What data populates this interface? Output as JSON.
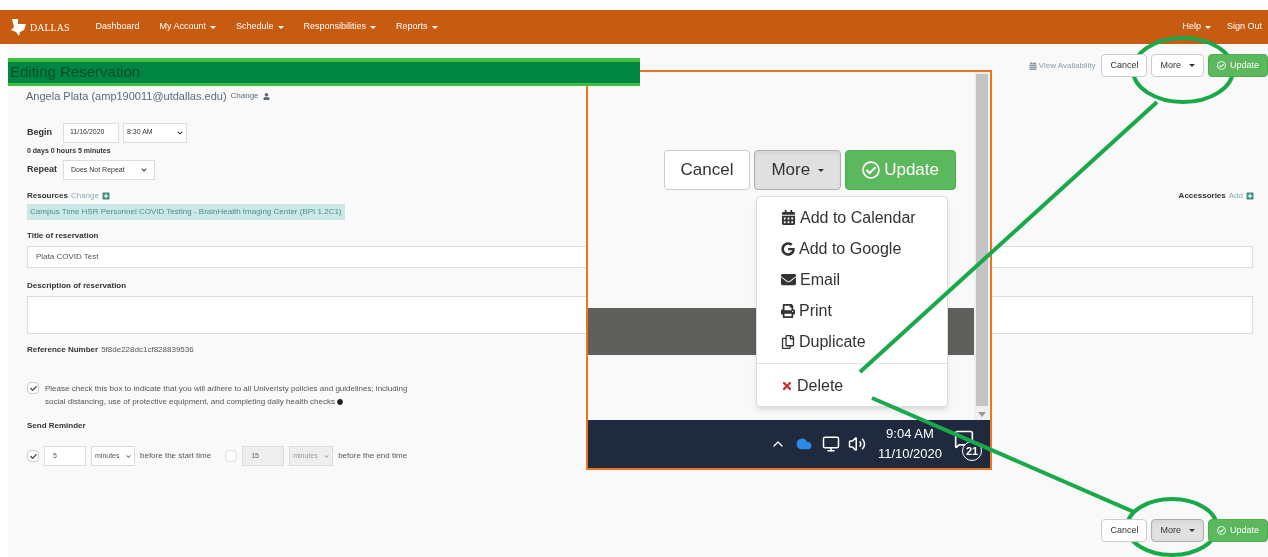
{
  "nav": {
    "logo_text": "DALLAS",
    "items": [
      {
        "label": "Dashboard",
        "dropdown": false
      },
      {
        "label": "My Account",
        "dropdown": true
      },
      {
        "label": "Schedule",
        "dropdown": true
      },
      {
        "label": "Responsibilities",
        "dropdown": true
      },
      {
        "label": "Reports",
        "dropdown": true
      }
    ],
    "right_items": [
      {
        "label": "Help",
        "dropdown": true
      },
      {
        "label": "Sign Out",
        "dropdown": false
      }
    ]
  },
  "header": {
    "title": "Editing Reservation"
  },
  "top_actions": {
    "view_availability": "View Availability",
    "buttons": [
      {
        "label": "Cancel",
        "kind": "default"
      },
      {
        "label": "More",
        "kind": "dropdown",
        "pressed": false
      },
      {
        "label": "Update",
        "kind": "primary"
      }
    ]
  },
  "owner": {
    "name": "Angela Plata (amp190011@utdallas.edu)",
    "link": "Change"
  },
  "begin": {
    "label": "Begin",
    "date": "11/16/2020",
    "time": "8:30 AM"
  },
  "duration": "0 days 0 hours 5 minutes",
  "repeat": {
    "label": "Repeat",
    "value": "Does Not Repeat"
  },
  "resources": {
    "label": "Resources",
    "link": "Change",
    "value": "Campus Time HSR Personnel COVID Testing - BrainHealth Imaging Center (BPI 1.2C1)"
  },
  "accessories": {
    "label": "Accessories",
    "link": "Add"
  },
  "title_field": {
    "label": "Title of reservation",
    "value": "Plata COVID Test"
  },
  "description_field": {
    "label": "Description of reservation"
  },
  "reference": {
    "label": "Reference Number",
    "value": "5f8de228dc1cf828839536"
  },
  "policy": {
    "checked": true,
    "text": "Please check this box to indicate that you will adhere to all Univeristy policies and guidelines; including social distancing, use of protective equipment, and completing daily health checks"
  },
  "reminder": {
    "label": "Send Reminder",
    "items": [
      {
        "checked": true,
        "disabled": false,
        "value": "5",
        "unit": "minutes",
        "text": "before the start time"
      },
      {
        "checked": false,
        "disabled": true,
        "value": "15",
        "unit": "minutes",
        "text": "before the end time"
      }
    ]
  },
  "bottom_actions": {
    "buttons": [
      {
        "label": "Cancel",
        "kind": "default"
      },
      {
        "label": "More",
        "kind": "dropdown",
        "pressed": true
      },
      {
        "label": "Update",
        "kind": "primary"
      }
    ]
  },
  "inset": {
    "buttons": [
      {
        "label": "Cancel",
        "kind": "default"
      },
      {
        "label": "More",
        "kind": "dropdown",
        "pressed": true
      },
      {
        "label": "Update",
        "kind": "primary"
      }
    ],
    "menu": [
      {
        "label": "Add to Calendar",
        "kind": "calendar"
      },
      {
        "label": "Add to Google",
        "kind": "google"
      },
      {
        "label": "Email",
        "kind": "email"
      },
      {
        "label": "Print",
        "kind": "print"
      },
      {
        "label": "Duplicate",
        "kind": "duplicate"
      },
      {
        "label": "Delete",
        "kind": "delete"
      }
    ],
    "taskbar": {
      "time": "9:04 AM",
      "date": "11/10/2020",
      "notifications": "21"
    }
  }
}
